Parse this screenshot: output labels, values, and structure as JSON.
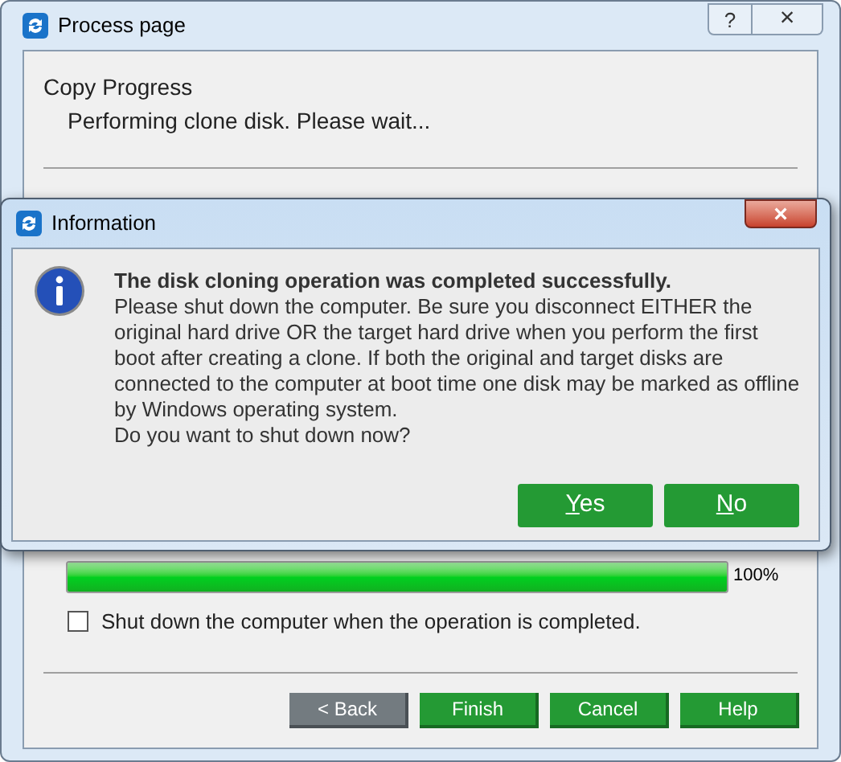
{
  "window": {
    "title": "Process page",
    "help_button": "?",
    "close_button": "×"
  },
  "section": {
    "title": "Copy Progress",
    "status": "Performing clone disk. Please wait..."
  },
  "progress": {
    "level": 1,
    "reading": "100%"
  },
  "shutdown_option": {
    "label": "Shut down the computer when the operation is completed.",
    "checked": false
  },
  "buttons": [
    {
      "label": "< Back",
      "disabled": true
    },
    {
      "label": "Finish",
      "disabled": false
    },
    {
      "label": "Cancel",
      "disabled": false
    },
    {
      "label": "Help",
      "disabled": false
    }
  ],
  "dialog": {
    "title": "Information",
    "close_button": "×",
    "heading": "The disk cloning operation was completed successfully.",
    "message": [
      "Please shut down the computer. Be sure you disconnect EITHER the original hard drive OR the target hard drive when you perform the first boot after creating a clone. If both the original and target disks are connected to the computer at boot time one disk may be marked as offline by Windows operating system.",
      "Do you want to shut down now?"
    ],
    "buttons": [
      {
        "label": "Yes"
      },
      {
        "label": "No"
      }
    ]
  }
}
